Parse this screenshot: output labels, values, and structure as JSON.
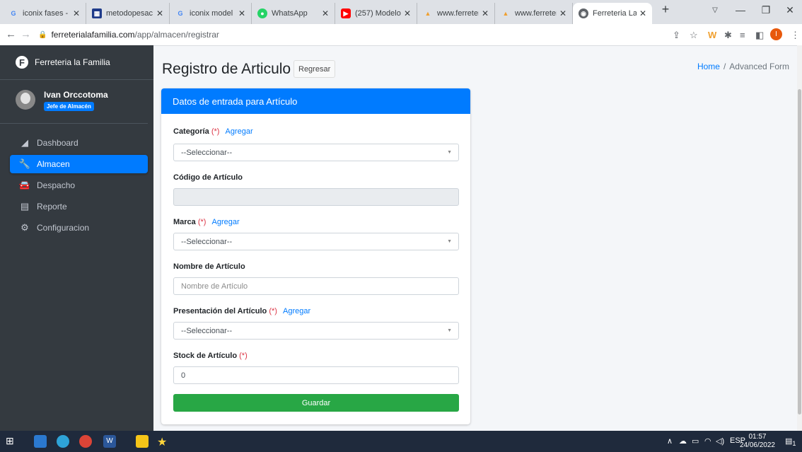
{
  "browser": {
    "tabs": [
      {
        "title": "iconix fases -",
        "favicon": "google-icon",
        "color": "#4285f4"
      },
      {
        "title": "metodopesac",
        "favicon": "doc-icon",
        "color": "#1f3b8a"
      },
      {
        "title": "iconix model",
        "favicon": "google-icon",
        "color": "#4285f4"
      },
      {
        "title": "WhatsApp",
        "favicon": "whatsapp-icon",
        "color": "#25d366"
      },
      {
        "title": "(257) Modelo",
        "favicon": "youtube-icon",
        "color": "#ff0000"
      },
      {
        "title": "www.ferreteri",
        "favicon": "ferreteria-icon",
        "color": "#f0a030"
      },
      {
        "title": "www.ferreteri",
        "favicon": "ferreteria-icon",
        "color": "#f0a030"
      },
      {
        "title": "Ferreteria La",
        "favicon": "globe-icon",
        "color": "#5f6368"
      }
    ],
    "url_host": "ferreterialafamilia.com",
    "url_path": "/app/almacen/registrar"
  },
  "sidebar": {
    "brand": "Ferreteria la Familia",
    "brand_logo": "F",
    "user_name": "Ivan Orccotoma",
    "user_role": "Jefe de Almacén",
    "items": [
      {
        "label": "Dashboard",
        "icon": "chart-area-icon",
        "glyph": "◢",
        "active": false
      },
      {
        "label": "Almacen",
        "icon": "wrench-icon",
        "glyph": "🔧",
        "active": true
      },
      {
        "label": "Despacho",
        "icon": "car-icon",
        "glyph": "🚘",
        "active": false
      },
      {
        "label": "Reporte",
        "icon": "file-icon",
        "glyph": "▤",
        "active": false
      },
      {
        "label": "Configuracion",
        "icon": "cogs-icon",
        "glyph": "⚙",
        "active": false
      }
    ]
  },
  "header": {
    "title": "Registro de Articulo",
    "back_button": "Regresar",
    "breadcrumb_home": "Home",
    "breadcrumb_sep": "/",
    "breadcrumb_current": "Advanced Form"
  },
  "form": {
    "card_title": "Datos de entrada para Artículo",
    "required_mark": "(*)",
    "add_link": "Agregar",
    "categoria_label": "Categoría",
    "categoria_value": "--Seleccionar--",
    "codigo_label": "Código de Artículo",
    "codigo_value": "",
    "marca_label": "Marca",
    "marca_value": "--Seleccionar--",
    "nombre_label": "Nombre de Artículo",
    "nombre_placeholder": "Nombre de Artículo",
    "presentacion_label": "Presentación del Artículo",
    "presentacion_value": "--Seleccionar--",
    "stock_label": "Stock de Artículo",
    "stock_value": "0",
    "save_button": "Guardar"
  },
  "taskbar": {
    "language": "ESP",
    "time": "01:57",
    "date": "24/06/2022",
    "notification_count": "1"
  },
  "colors": {
    "primary": "#007bff",
    "success": "#28a745",
    "danger": "#dc3545",
    "sidebar_bg": "#343a40"
  }
}
